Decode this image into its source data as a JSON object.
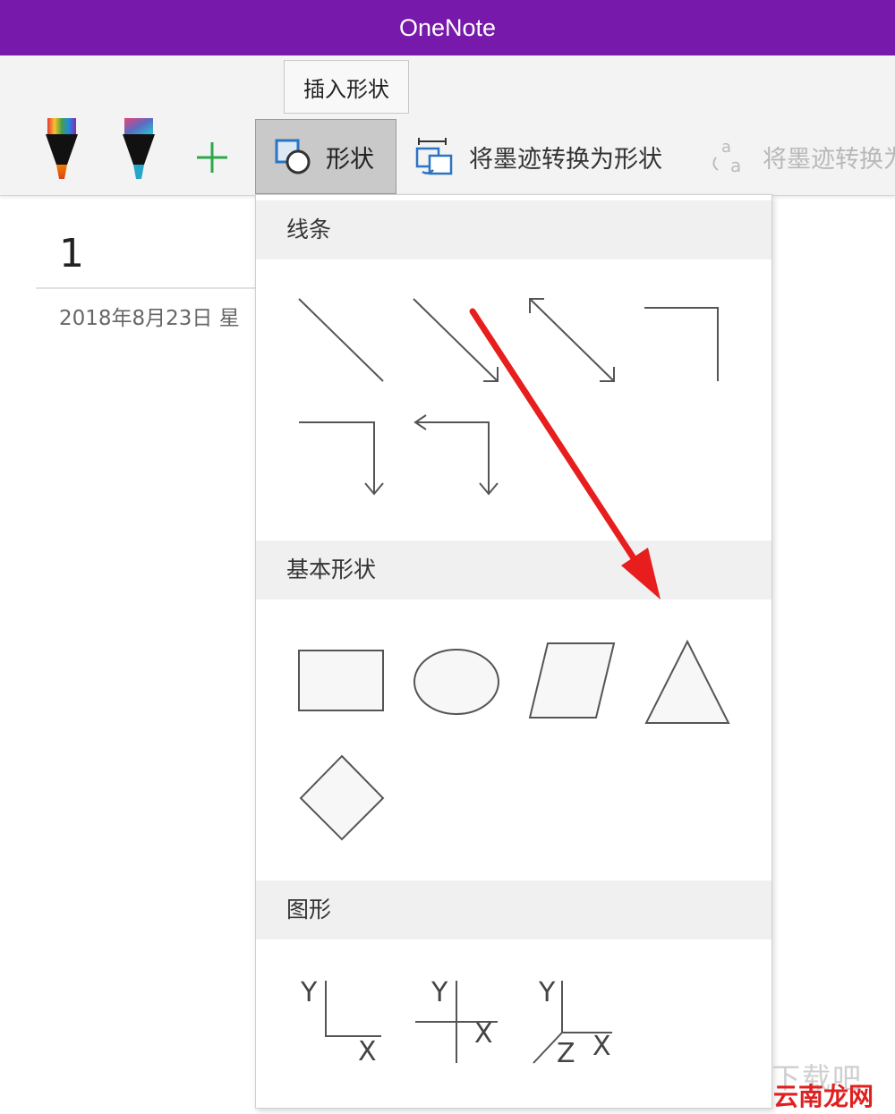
{
  "app": {
    "title": "OneNote"
  },
  "ribbon": {
    "tooltip": "插入形状",
    "shapes_button": "形状",
    "convert_ink_to_shape": "将墨迹转换为形状",
    "convert_ink_to_text_truncated": "将墨迹转换为"
  },
  "page": {
    "number": "1",
    "date": "2018年8月23日 星"
  },
  "shapes_menu": {
    "sections": [
      {
        "title": "线条"
      },
      {
        "title": "基本形状"
      },
      {
        "title": "图形"
      }
    ],
    "graph_axes": {
      "y": "Y",
      "x": "X",
      "z": "Z"
    }
  },
  "watermark": {
    "top": "下载吧",
    "bottom": "云南龙网"
  },
  "colors": {
    "title_bar": "#7719aa",
    "accent_green": "#2ea84a",
    "annotation_red": "#e81e1e"
  },
  "icons": [
    "rainbow-pen-icon",
    "galaxy-pen-icon",
    "plus-icon",
    "insert-shape-icon",
    "ink-to-shape-icon",
    "ink-to-text-icon"
  ]
}
